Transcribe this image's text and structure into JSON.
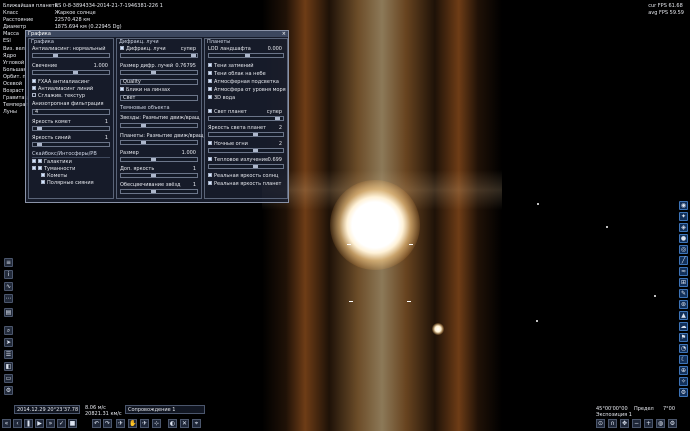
{
  "info": {
    "rows": [
      {
        "label": "Ближайшая планета",
        "value": "RS 0-8-3894334-2014-21-7-1946381-226 1"
      },
      {
        "label": "Класс",
        "value": "Жаркое солнце"
      },
      {
        "label": "Расстояние",
        "value": "22570.428 км"
      },
      {
        "label": "Диаметр",
        "value": "1875.694 км (0.22945 Dg)"
      },
      {
        "label": "Масса",
        "value": ""
      },
      {
        "label": "ESI",
        "value": ""
      },
      {
        "label": "Виз. вел",
        "value": ""
      },
      {
        "label": "Ядро",
        "value": ""
      },
      {
        "label": "Угловой",
        "value": ""
      },
      {
        "label": "Большая",
        "value": ""
      },
      {
        "label": "Орбит. п",
        "value": ""
      },
      {
        "label": "Осевой",
        "value": ""
      },
      {
        "label": "Возраст",
        "value": ""
      },
      {
        "label": "Гравитац",
        "value": ""
      },
      {
        "label": "Температ",
        "value": ""
      },
      {
        "label": "Луны",
        "value": ""
      }
    ]
  },
  "fps": {
    "cur": "cur FPS 61.68",
    "avg": "avg FPS 59.59"
  },
  "window": {
    "title": "Графика",
    "close": "×",
    "col1": {
      "title": "Графика",
      "anisotropy": "Антиалиасинг: нормальный",
      "fxaa": "FXAA антиалиасинг",
      "antialias_lines": "Антиалиасинг линий",
      "smooth_text": "Сглажив. текстур",
      "brightness_label": "Свечение",
      "brightness_val": "1.000",
      "aniso_filter": "Анизотропная фильтрация",
      "aniso_select": "4",
      "comet_brightness": "Яркость комет",
      "comet_val": "1",
      "shadow_brightness": "Яркость синий",
      "shadow_val": "1",
      "skybox_group": "Скайбокс/Интосферы/РВ",
      "galaxies": "Галактики",
      "nebulae": "Туманности",
      "comets": "Кометы",
      "polar_lights": "Полярные сияния"
    },
    "col2": {
      "title": "Дифракц. лучи",
      "diffraction": "Дифракц. лучи",
      "super": "супер",
      "size_label": "Размер дифр. лучей",
      "size_val": "0.76795",
      "quality_select": "Quality",
      "glare_lenses": "Блики на линзах",
      "lens_select": "Свет",
      "dark_objects": "Темновые объекта",
      "stars_blur": "Звезды: Размытие движ/вращ",
      "planets_blur": "Планеты: Размытие движ/вращ",
      "size2_label": "Размер",
      "size2_val": "1.000",
      "exposure_label": "Доп. яркость",
      "exposure_val": "1",
      "stars_exposure": "Обесцвечивание звёзд",
      "stars_exposure_val": "1"
    },
    "col3": {
      "title": "Планеты",
      "lod_label": "LOD ландшафта",
      "lod_val": "0.000",
      "shadows": "Тени затмений",
      "clouds": "Тени облак на небе",
      "atmo_corona": "Атмосферная подсветка",
      "atmo_sea": "Атмосфера от уровня моря",
      "water_3d": "3D вода",
      "planet_light": "Свет планет",
      "planet_light_val": "супер",
      "planet_brightness": "Яркость света планет",
      "planet_brightness_val": "2",
      "night_lights": "Ночные огни",
      "night_lights_val": "2",
      "thermal": "Тепловое излучение",
      "thermal_val": "0.699",
      "real_sun": "Реальная яркость солнц",
      "real_planets": "Реальная яркость планет"
    }
  },
  "bottom": {
    "date": "2014.12.29 20°23'37.78",
    "speed": "8.06 м/с",
    "speed2": "20821.31 км/с",
    "follow": "Сопровождение 1",
    "coords": "45°00'00\"00",
    "exposure": "Экспозиция 1",
    "limit": "Предел",
    "fov": "7°00"
  }
}
